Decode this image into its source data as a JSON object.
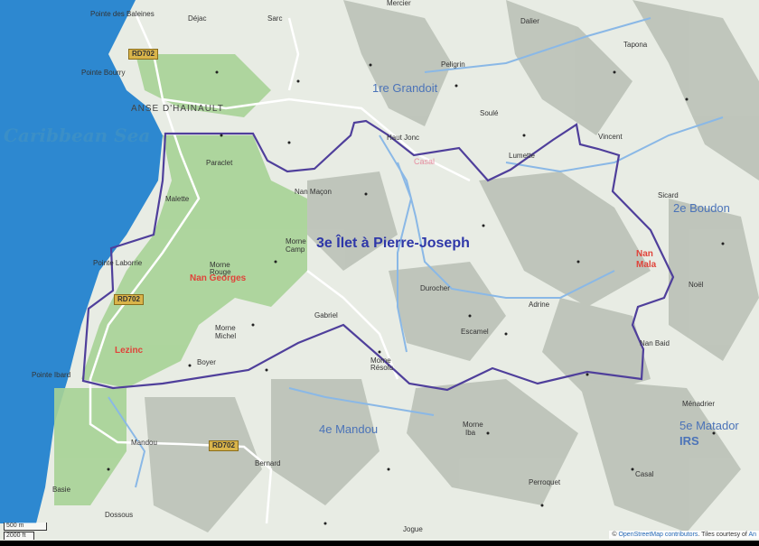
{
  "map": {
    "title": "3e Îlet à Pierre-Joseph",
    "sea_label": "Caribbean Sea",
    "town": "ANSE D'HAINAULT",
    "districts": [
      "1re Grandoit",
      "2e Boudon",
      "4e Mandou",
      "5e Matador",
      "IRS"
    ],
    "red_labels": [
      "Nan Georges",
      "Lezinc",
      "Nan",
      "Mala"
    ],
    "pink_label": "Casal",
    "places": [
      "Pointe des Baleines",
      "Déjac",
      "Sarc",
      "Mercier",
      "Dalier",
      "Tapona",
      "Pointe Bourry",
      "Peligrin",
      "Soulé",
      "Paraclet",
      "Haut Jonc",
      "Lumette",
      "Vincent",
      "Malette",
      "Nan Maçon",
      "Sicard",
      "Morne",
      "Camp",
      "Pointe Laborrie",
      "Morne",
      "Rouge",
      "Durocher",
      "Noël",
      "Adrine",
      "Gabriel",
      "Morne",
      "Michel",
      "Escamel",
      "Nan Baid",
      "Boyer",
      "Pointe Ibard",
      "Morne",
      "Résolu",
      "Ménadrier",
      "Morne",
      "Iba",
      "Mandou",
      "Casal",
      "Bernard",
      "Basie",
      "Perroquet",
      "Dossous",
      "Jogue"
    ],
    "road_shields": [
      "RD702",
      "RD702",
      "RD702"
    ],
    "scale": {
      "metric": "500 m",
      "imperial": "2000 ft"
    },
    "attribution": {
      "prefix": "©",
      "link": "OpenStreetMap contributors",
      "tiles": ". Tiles courtesy of",
      "tiles_link": "An"
    }
  },
  "colors": {
    "boundary": "#4f3f9b",
    "sea": "#2d88d0",
    "river": "#8ab8e6",
    "forest": "#9fcf8f",
    "road": "#ffffff"
  }
}
